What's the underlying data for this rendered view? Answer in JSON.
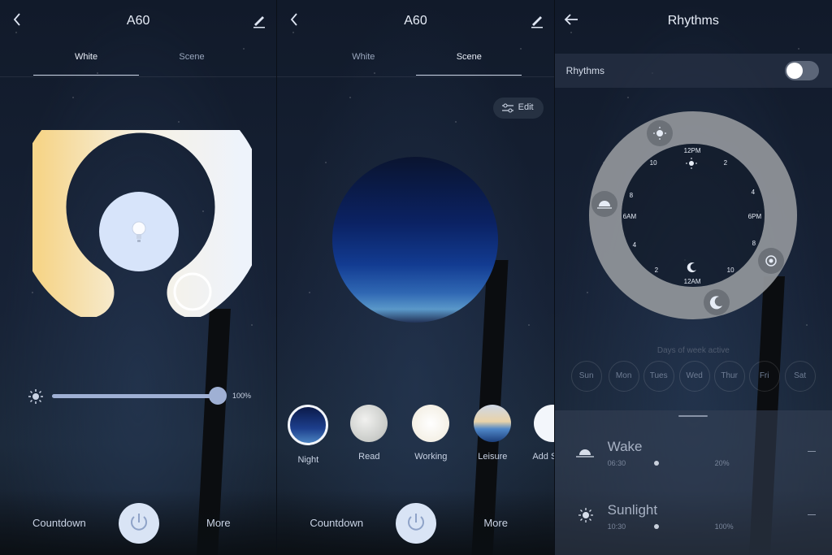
{
  "panel1": {
    "title": "A60",
    "tabs": [
      "White",
      "Scene"
    ],
    "brightness": "100%",
    "brightness_level": 1.0,
    "countdown": "Countdown",
    "more": "More"
  },
  "panel2": {
    "title": "A60",
    "tabs": [
      "White",
      "Scene"
    ],
    "edit": "Edit",
    "scenes": [
      {
        "label": "Night"
      },
      {
        "label": "Read"
      },
      {
        "label": "Working"
      },
      {
        "label": "Leisure"
      },
      {
        "label": "Add S"
      }
    ],
    "countdown": "Countdown",
    "more": "More"
  },
  "panel3": {
    "title": "Rhythms",
    "toggle_label": "Rhythms",
    "toggle_on": false,
    "clock": {
      "top": "12PM",
      "bottom": "12AM",
      "left": "6AM",
      "right": "6PM",
      "n10a": "10",
      "n2a": "2",
      "n8a": "8",
      "n4a": "4",
      "n4b": "4",
      "n8b": "8",
      "n2b": "2",
      "n10b": "10"
    },
    "days_label": "Days of week active",
    "days": [
      "Sun",
      "Mon",
      "Tues",
      "Wed",
      "Thur",
      "Fri",
      "Sat"
    ],
    "schedule": [
      {
        "name": "Wake",
        "time": "06:30",
        "pct": "20%"
      },
      {
        "name": "Sunlight",
        "time": "10:30",
        "pct": "100%"
      }
    ]
  },
  "colors": {
    "accent": "#9fb0d4",
    "warm": "#f6d58a",
    "cool": "#eef3fb"
  }
}
